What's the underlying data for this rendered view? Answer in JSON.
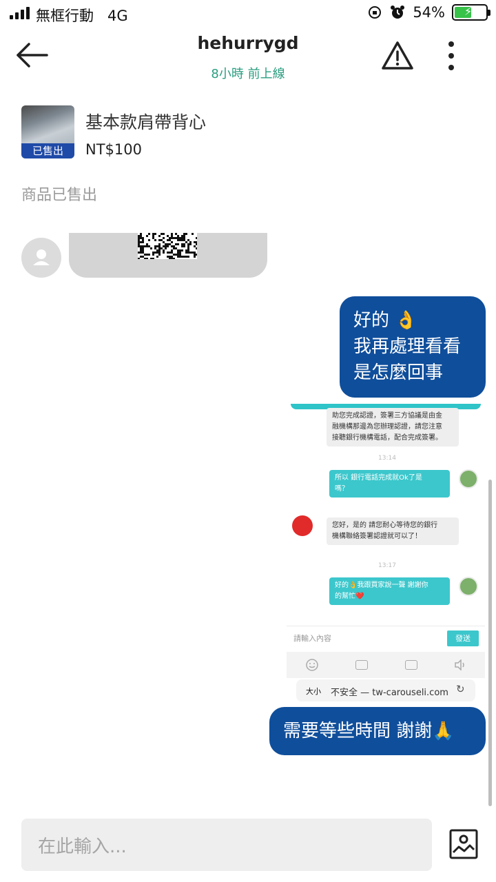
{
  "status_bar": {
    "carrier": "無框行動",
    "network": "4G",
    "battery_percent": "54%",
    "battery_level": 0.54
  },
  "header": {
    "username": "hehurrygd",
    "last_online": "8小時 前上線"
  },
  "product": {
    "title": "基本款肩帶背心",
    "price": "NT$100",
    "badge": "已售出",
    "sold_note": "商品已售出"
  },
  "messages": {
    "outgoing_1_lines": [
      "好的 👌",
      "我再處理看看",
      "是怎麼回事"
    ],
    "outgoing_2": "需要等些時間 謝謝🙏"
  },
  "embedded_screenshot": {
    "msg_top_line1": "助您完成認證，簽署三方協議是由金",
    "msg_top_line2": "融機構那邊為您辦理認證，請您注意",
    "msg_top_line3": "接聽銀行機構電話，配合完成簽署。",
    "time_1": "13:14",
    "msg_user_1_line1": "所以 銀行電話完成就Ok了是",
    "msg_user_1_line2": "嗎？",
    "msg_agent_line1": "您好，是的 請您耐心等待您的銀行",
    "msg_agent_line2": "機構聯絡簽署認證就可以了！",
    "time_2": "13:17",
    "msg_user_2_line1": "好的👌我跟買家說一聲 謝謝你",
    "msg_user_2_line2": "的幫忙❤️",
    "input_placeholder": "請輸入內容",
    "send_label": "發送",
    "url_text_size": "大小",
    "url": "不安全 — tw-carouseli.com"
  },
  "composer": {
    "placeholder": "在此輸入..."
  },
  "colors": {
    "accent_green": "#2a9d7f",
    "bubble_blue": "#0f4e9b",
    "sold_badge": "#1f4aa8",
    "teal": "#3cc7cc"
  },
  "icons": {
    "back": "arrow-left-icon",
    "report": "warning-triangle-icon",
    "more": "vertical-dots-icon",
    "photo": "image-icon",
    "avatar": "user-placeholder-icon"
  }
}
